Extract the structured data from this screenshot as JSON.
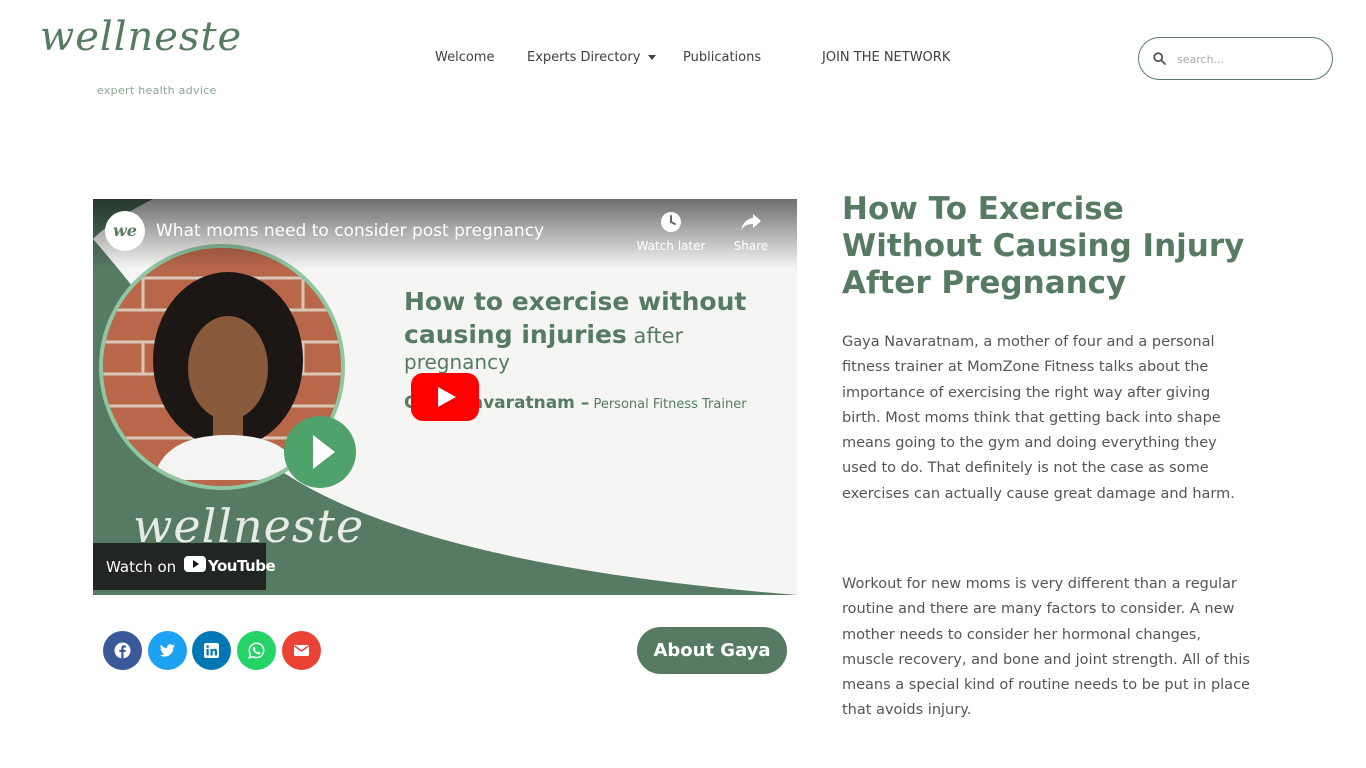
{
  "header": {
    "logo_text": "wellneste",
    "logo_tagline": "expert health advice",
    "nav": {
      "welcome": "Welcome",
      "experts": "Experts Directory",
      "publications": "Publications",
      "join": "JOIN THE NETWORK"
    },
    "search": {
      "placeholder": "search..."
    }
  },
  "video": {
    "channel_avatar": "we",
    "title": "What moms need to consider post pregnancy",
    "watch_later": "Watch later",
    "share": "Share",
    "thumb_line1": "How to exercise without",
    "thumb_line2_bold": "causing injuries",
    "thumb_line2_rest": " after",
    "thumb_line3": "pregnancy",
    "thumb_presenter": "Gaya Navaratnam –",
    "thumb_role": " Personal Fitness Trainer",
    "watermark": "wellneste",
    "watch_on": "Watch on",
    "youtube": "YouTube"
  },
  "share_buttons": [
    "facebook-icon",
    "twitter-icon",
    "linkedin-icon",
    "whatsapp-icon",
    "email-icon"
  ],
  "about_button": "About Gaya",
  "article": {
    "title_pre": "How To ",
    "title_bold": "Exercise Without Causing Injury",
    "title_post": " After Pregnancy",
    "para1": "Gaya Navaratnam, a mother of four and a personal fitness trainer at MomZone Fitness talks about the importance of exercising the right way after giving birth.  Most moms think that getting back into shape means going to the gym and doing everything they used to do.  That definitely is not the case as some exercises can actually cause great damage and harm.",
    "para2": "Workout for new moms is very different than a regular routine and there are many factors to consider. A new mother needs to consider her hormonal changes, muscle recovery, and bone and joint strength.  All of this means a special kind of routine needs to be put in place that avoids injury."
  },
  "colors": {
    "brand_green": "#567a62",
    "accent_green": "#4fa26a",
    "youtube_red": "#ff0000"
  }
}
